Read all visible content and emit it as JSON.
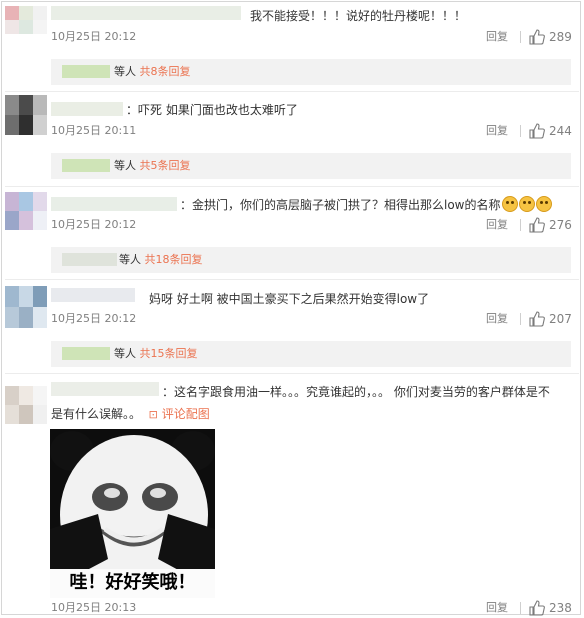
{
  "colors": {
    "link": "#eb7350",
    "muted": "#808080",
    "text": "#333333",
    "subbox": "#f2f2f2"
  },
  "comments": [
    {
      "text": "我不能接受！！！说好的牡丹楼呢！！！",
      "time": "10月25日 20:12",
      "reply_label": "回复",
      "likes": "289",
      "sub": {
        "suffix": "等人",
        "count_link": "共8条回复"
      }
    },
    {
      "text": "：吓死 如果门面也改也太难听了",
      "time": "10月25日 20:11",
      "reply_label": "回复",
      "likes": "244",
      "sub": {
        "suffix": "等人",
        "count_link": "共5条回复"
      }
    },
    {
      "text": "：金拱门，你们的高层脑子被门拱了？相得出那么low的名称",
      "time": "10月25日 20:12",
      "reply_label": "回复",
      "likes": "276",
      "sub": {
        "suffix": "等人",
        "count_link": "共18条回复"
      }
    },
    {
      "text": "妈呀 好土啊 被中国土豪买下之后果然开始变得low了",
      "time": "10月25日 20:12",
      "reply_label": "回复",
      "likes": "207",
      "sub": {
        "suffix": "等人",
        "count_link": "共15条回复"
      }
    },
    {
      "text_line1": "：这名字跟食用油一样。。。究竟谁起的，。。 你们对麦当劳的客户群体是不",
      "text_line2": "是有什么误解。。",
      "pic_link": "评论配图",
      "meme_caption": "哇！好好笑哦！",
      "time": "10月25日 20:13",
      "reply_label": "回复",
      "likes": "238"
    }
  ]
}
